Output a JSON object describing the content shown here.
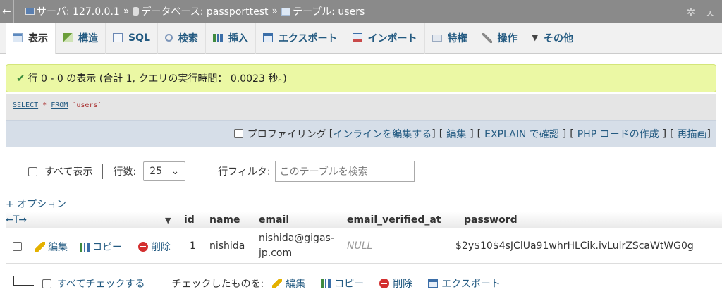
{
  "breadcrumb": {
    "back": "←",
    "server": "サーバ: 127.0.0.1",
    "database": "データベース: passporttest",
    "table": "テーブル: users",
    "separator": "»",
    "settings_icon": "gear-icon",
    "collapse_icon": "collapse-icon",
    "settings_glyph": "✲",
    "collapse_glyph": "ㅈ"
  },
  "tabs": [
    {
      "label": "表示",
      "icon": "browse-icon"
    },
    {
      "label": "構造",
      "icon": "structure-icon"
    },
    {
      "label": "SQL",
      "icon": "sql-icon"
    },
    {
      "label": "検索",
      "icon": "search-icon"
    },
    {
      "label": "挿入",
      "icon": "insert-icon"
    },
    {
      "label": "エクスポート",
      "icon": "export-icon"
    },
    {
      "label": "インポート",
      "icon": "import-icon"
    },
    {
      "label": "特権",
      "icon": "privileges-icon"
    },
    {
      "label": "操作",
      "icon": "operations-icon"
    },
    {
      "label": "その他",
      "icon": "more-icon"
    }
  ],
  "more_glyph": "▼",
  "message": {
    "check": "✔",
    "text": "行 0 - 0 の表示 (合計 1, クエリの実行時間： 0.0023 秒。)"
  },
  "sql": {
    "select": "SELECT",
    "star": " * ",
    "from": "FROM",
    "table": " `users`",
    "actions": {
      "profiling": "プロファイリング",
      "inline_edit": "インラインを編集する",
      "edit": "編集",
      "explain": "EXPLAIN で確認",
      "php": "PHP コードの作成",
      "refresh": "再描画",
      "lb": "[",
      "rb": "]"
    }
  },
  "nav": {
    "show_all": "すべて表示",
    "rows_label": "行数:",
    "rows_value": "25",
    "select_glyph": "⌄",
    "filter_label": "行フィルタ:",
    "filter_placeholder": "このテーブルを検索"
  },
  "options_link": "+ オプション",
  "table": {
    "arrows": "←T→",
    "sort_glyph": "▼",
    "columns": [
      "id",
      "name",
      "email",
      "email_verified_at",
      "password"
    ],
    "rows": [
      {
        "edit": "編集",
        "copy": "コピー",
        "delete": "削除",
        "id": "1",
        "name": "nishida",
        "email_line1": "nishida@gigas-",
        "email_line2": "jp.com",
        "email_verified_at": "NULL",
        "password": "$2y$10$4sJClUa91whrHLCik.ivLulrZScaWtWG0g"
      }
    ]
  },
  "bottom": {
    "check_all": "すべてチェックする",
    "with_selected": "チェックしたものを:",
    "edit": "編集",
    "copy": "コピー",
    "delete": "削除",
    "export": "エクスポート"
  }
}
